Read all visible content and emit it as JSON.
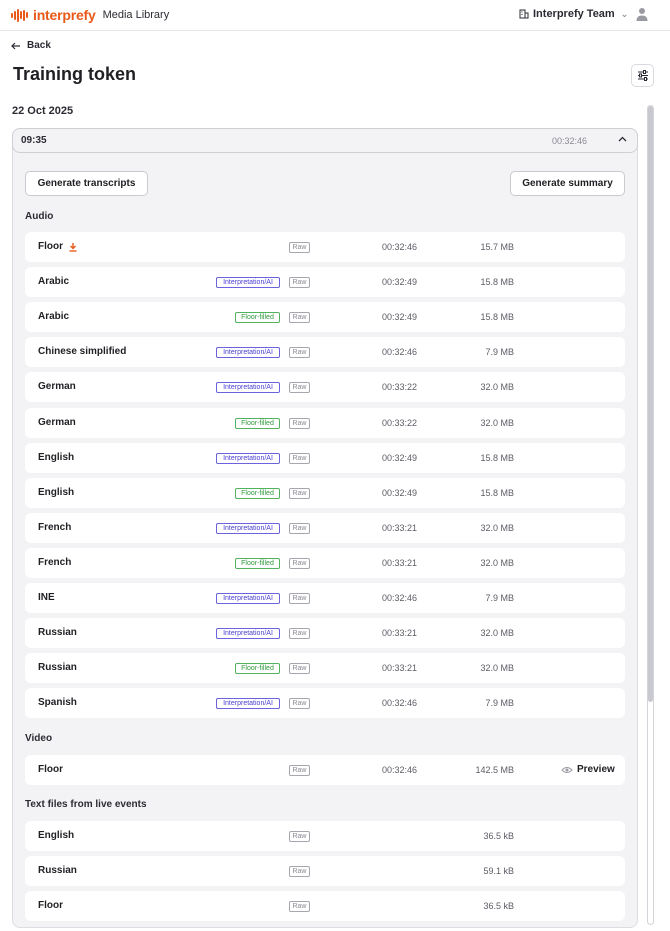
{
  "app": {
    "brand": "interprefy",
    "app_name": "Media Library",
    "brand_color": "#e8591a",
    "team": "Interprefy Team"
  },
  "header": {
    "back_label": "Back",
    "title": "Training token"
  },
  "date": "22 Oct 2025",
  "session": {
    "time": "09:35",
    "duration": "00:32:46",
    "generate_transcripts_label": "Generate transcripts",
    "generate_summary_label": "Generate summary"
  },
  "audio": {
    "label": "Audio",
    "rows": [
      {
        "name": "Floor",
        "download": true,
        "badge": "",
        "raw": "Raw",
        "duration": "00:32:46",
        "size": "15.7 MB"
      },
      {
        "name": "Arabic",
        "badge": "Interpretation/AI",
        "badge_type": "interp",
        "raw": "Raw",
        "duration": "00:32:49",
        "size": "15.8 MB"
      },
      {
        "name": "Arabic",
        "badge": "Floor-filled",
        "badge_type": "floor",
        "raw": "Raw",
        "duration": "00:32:49",
        "size": "15.8 MB"
      },
      {
        "name": "Chinese simplified",
        "badge": "Interpretation/AI",
        "badge_type": "interp",
        "raw": "Raw",
        "duration": "00:32:46",
        "size": "7.9 MB"
      },
      {
        "name": "German",
        "badge": "Interpretation/AI",
        "badge_type": "interp",
        "raw": "Raw",
        "duration": "00:33:22",
        "size": "32.0 MB"
      },
      {
        "name": "German",
        "badge": "Floor-filled",
        "badge_type": "floor",
        "raw": "Raw",
        "duration": "00:33:22",
        "size": "32.0 MB"
      },
      {
        "name": "English",
        "badge": "Interpretation/AI",
        "badge_type": "interp",
        "raw": "Raw",
        "duration": "00:32:49",
        "size": "15.8 MB"
      },
      {
        "name": "English",
        "badge": "Floor-filled",
        "badge_type": "floor",
        "raw": "Raw",
        "duration": "00:32:49",
        "size": "15.8 MB"
      },
      {
        "name": "French",
        "badge": "Interpretation/AI",
        "badge_type": "interp",
        "raw": "Raw",
        "duration": "00:33:21",
        "size": "32.0 MB"
      },
      {
        "name": "French",
        "badge": "Floor-filled",
        "badge_type": "floor",
        "raw": "Raw",
        "duration": "00:33:21",
        "size": "32.0 MB"
      },
      {
        "name": "INE",
        "badge": "Interpretation/AI",
        "badge_type": "interp",
        "raw": "Raw",
        "duration": "00:32:46",
        "size": "7.9 MB"
      },
      {
        "name": "Russian",
        "badge": "Interpretation/AI",
        "badge_type": "interp",
        "raw": "Raw",
        "duration": "00:33:21",
        "size": "32.0 MB"
      },
      {
        "name": "Russian",
        "badge": "Floor-filled",
        "badge_type": "floor",
        "raw": "Raw",
        "duration": "00:33:21",
        "size": "32.0 MB"
      },
      {
        "name": "Spanish",
        "badge": "Interpretation/AI",
        "badge_type": "interp",
        "raw": "Raw",
        "duration": "00:32:46",
        "size": "7.9 MB"
      }
    ]
  },
  "video": {
    "label": "Video",
    "rows": [
      {
        "name": "Floor",
        "raw": "Raw",
        "duration": "00:32:46",
        "size": "142.5 MB",
        "preview": "Preview"
      }
    ]
  },
  "text_files": {
    "label": "Text files from live events",
    "rows": [
      {
        "name": "English",
        "raw": "Raw",
        "size": "36.5 kB"
      },
      {
        "name": "Russian",
        "raw": "Raw",
        "size": "59.1 kB"
      },
      {
        "name": "Floor",
        "raw": "Raw",
        "size": "36.5 kB"
      }
    ]
  }
}
